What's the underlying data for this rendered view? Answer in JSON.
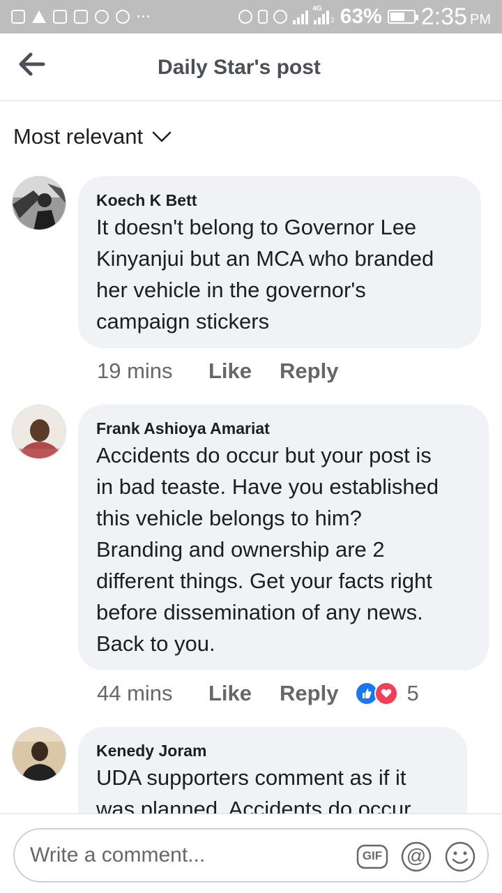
{
  "status_bar": {
    "battery": "63%",
    "battery_level": 0.63,
    "time": "2:35",
    "ampm": "PM",
    "network_label": "4G",
    "sim_slot": "2"
  },
  "header": {
    "title": "Daily Star's post",
    "back_icon": "arrow-left-icon"
  },
  "sort": {
    "label": "Most relevant",
    "icon": "chevron-down-icon"
  },
  "comments": [
    {
      "author": "Koech K Bett",
      "lines": [
        "It doesn't belong to Governor Lee",
        "Kinyanjui but an MCA who branded",
        "her vehicle in the governor's",
        "campaign stickers"
      ],
      "time": "19 mins",
      "like_label": "Like",
      "reply_label": "Reply"
    },
    {
      "author": "Frank Ashioya Amariat",
      "lines": [
        "Accidents do occur but your post is",
        "in bad teaste. Have you established",
        "this vehicle belongs to him?",
        "Branding and ownership are 2",
        "different things. Get your facts right",
        "before dissemination of any news.",
        "Back to you."
      ],
      "time": "44 mins",
      "like_label": "Like",
      "reply_label": "Reply",
      "reaction_count": "5",
      "reaction_icons": [
        "like-reaction-icon",
        "love-reaction-icon"
      ]
    },
    {
      "author": "Kenedy Joram",
      "lines": [
        "UDA supporters comment as if it",
        "was planned. Accidents do occur"
      ]
    }
  ],
  "composer": {
    "placeholder": "Write a comment...",
    "gif_label": "GIF",
    "mention_symbol": "@",
    "icons": [
      "gif-icon",
      "mention-icon",
      "emoji-icon"
    ]
  },
  "colors": {
    "status_bar_bg": "#bdbdbd",
    "bubble_bg": "#f0f2f5",
    "like_blue": "#1877f2",
    "love_red": "#f33e58",
    "meta_gray": "#65676b"
  }
}
